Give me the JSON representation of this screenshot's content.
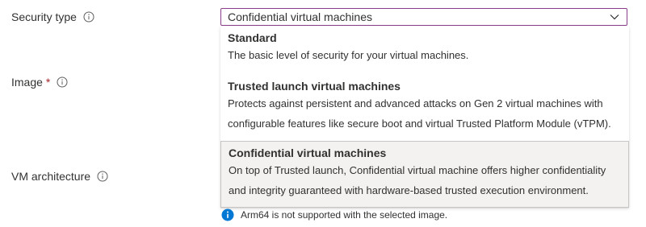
{
  "fields": {
    "security_type": {
      "label": "Security type"
    },
    "image": {
      "label": "Image",
      "required_mark": "*"
    },
    "vm_architecture": {
      "label": "VM architecture"
    }
  },
  "security_select": {
    "value": "Confidential virtual machines"
  },
  "options": [
    {
      "title": "Standard",
      "desc": [
        "The basic level of security for your virtual machines."
      ]
    },
    {
      "title": "Trusted launch virtual machines",
      "desc": [
        "Protects against persistent and advanced attacks on Gen 2 virtual machines with",
        "configurable features like secure boot and virtual Trusted Platform Module (vTPM)."
      ]
    },
    {
      "title": "Confidential virtual machines",
      "desc": [
        "On top of Trusted launch, Confidential virtual machine offers higher confidentiality",
        "and integrity guaranteed with hardware-based trusted execution environment."
      ],
      "selected": true
    }
  ],
  "notice": {
    "text": "Arm64 is not supported with the selected image.",
    "icon": "info-filled-icon"
  },
  "colors": {
    "required": "#a4262c",
    "info_blue": "#0078d4",
    "focus_border": "#8a3d8a",
    "selected_bg": "#f3f2f1"
  }
}
